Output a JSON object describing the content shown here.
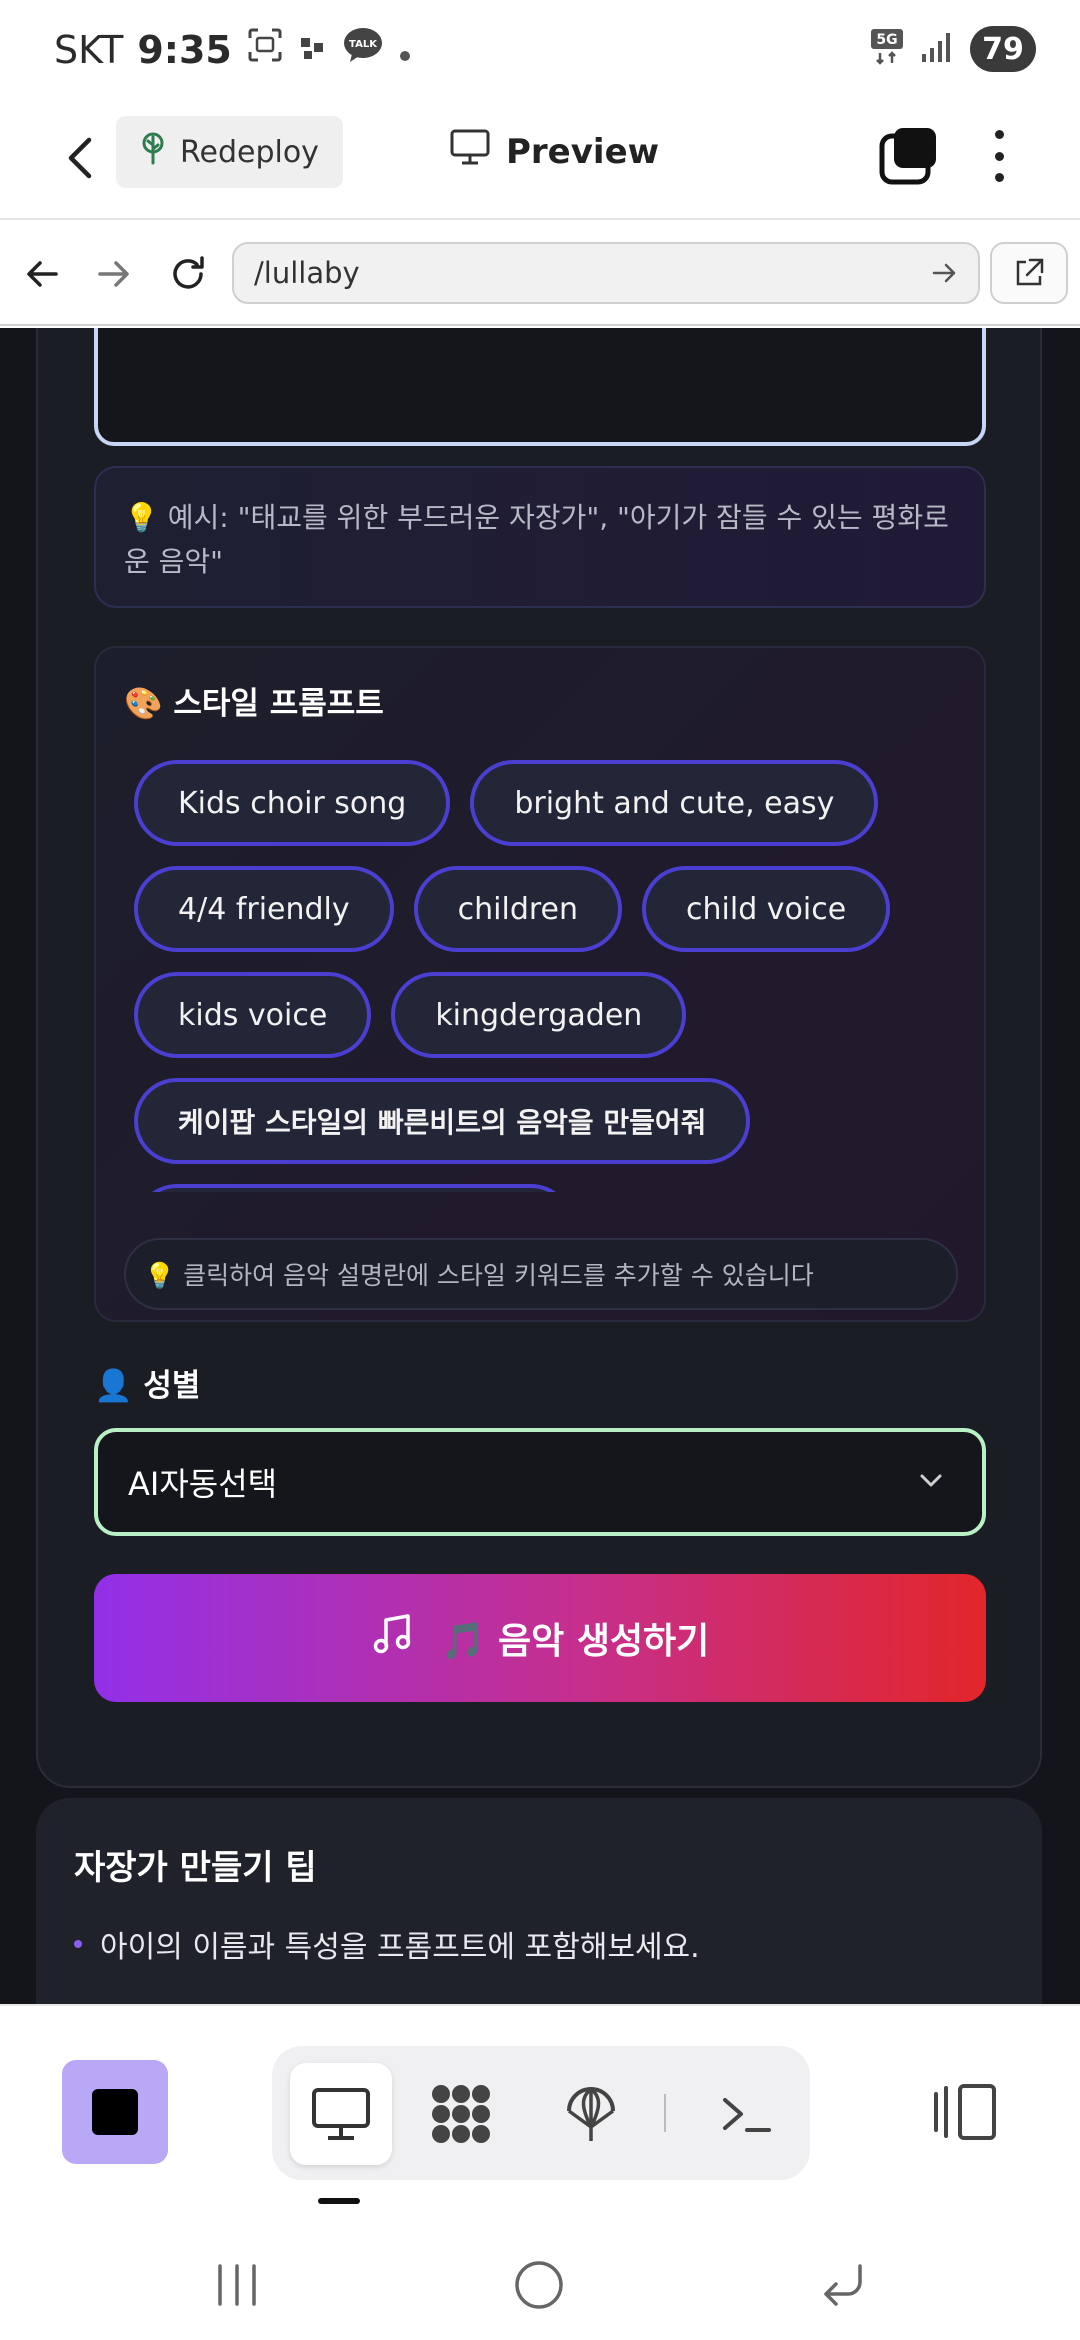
{
  "status_bar": {
    "carrier": "SKT",
    "time": "9:35",
    "network": "5G",
    "battery": "79",
    "icons": [
      "screenshot-icon",
      "app-notification-icon",
      "talk-icon",
      "dot-icon",
      "5g-icon",
      "signal-icon",
      "battery-icon"
    ]
  },
  "app_bar": {
    "redeploy_label": "Redeploy",
    "preview_label": "Preview",
    "icons": [
      "back-arrow-icon",
      "deploy-tree-icon",
      "monitor-icon",
      "windows-icon",
      "more-vertical-icon"
    ]
  },
  "browser": {
    "url": "/lullaby",
    "icons": [
      "nav-back-icon",
      "nav-forward-icon",
      "reload-icon",
      "go-arrow-icon",
      "open-external-icon"
    ]
  },
  "form": {
    "example_text": "💡 예시: \"태교를 위한 부드러운 자장가\", \"아기가 잠들 수 있는 평화로운 음악\"",
    "style_section": {
      "title": "🎨 스타일 프롬프트",
      "chips": [
        "Kids choir song",
        "bright and cute, easy",
        "4/4 friendly",
        "children",
        "child voice",
        "kids voice",
        "kingdergaden",
        "케이팝 스타일의 빠른비트의 음악을 만들어줘",
        ""
      ],
      "hint": "💡 클릭하여 음악 설명란에 스타일 키워드를 추가할 수 있습니다"
    },
    "gender": {
      "label": "👤 성별",
      "selected": "AI자동선택"
    },
    "generate_button": "🎵 음악 생성하기"
  },
  "tips": {
    "title": "자장가 만들기 팁",
    "items": [
      "아이의 이름과 특성을 프롬프트에 포함해보세요."
    ]
  },
  "toolbar": {
    "icons": [
      "stop-icon",
      "desktop-icon",
      "apps-grid-icon",
      "network-icon",
      "terminal-icon",
      "layout-icon"
    ]
  },
  "colors": {
    "content_bg": "#13151b",
    "chip_border": "#4a3fd0",
    "select_border": "#b9f0c6",
    "button_gradient_start": "#9230e8",
    "button_gradient_end": "#e2262a",
    "stop_button": "#b9a8f6"
  }
}
